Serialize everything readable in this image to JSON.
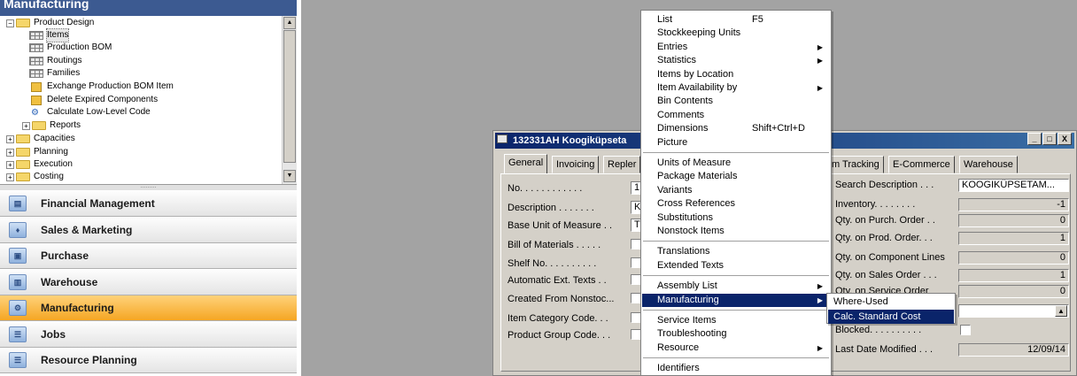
{
  "header": {
    "title": "Manufacturing"
  },
  "tree": [
    {
      "label": "Product Design",
      "kind": "folder-open",
      "level": 0
    },
    {
      "label": "Items",
      "kind": "grid",
      "level": 1,
      "selected": true
    },
    {
      "label": "Production BOM",
      "kind": "grid",
      "level": 1
    },
    {
      "label": "Routings",
      "kind": "grid",
      "level": 1
    },
    {
      "label": "Families",
      "kind": "grid",
      "level": 1
    },
    {
      "label": "Exchange Production BOM Item",
      "kind": "report",
      "level": 1
    },
    {
      "label": "Delete Expired Components",
      "kind": "report",
      "level": 1
    },
    {
      "label": "Calculate Low-Level Code",
      "kind": "calc",
      "level": 1
    },
    {
      "label": "Reports",
      "kind": "folder",
      "level": 1
    },
    {
      "label": "Capacities",
      "kind": "folder",
      "level": 0
    },
    {
      "label": "Planning",
      "kind": "folder",
      "level": 0
    },
    {
      "label": "Execution",
      "kind": "folder",
      "level": 0
    },
    {
      "label": "Costing",
      "kind": "folder",
      "level": 0
    }
  ],
  "nav": [
    {
      "label": "Financial Management",
      "active": false
    },
    {
      "label": "Sales & Marketing",
      "active": false
    },
    {
      "label": "Purchase",
      "active": false
    },
    {
      "label": "Warehouse",
      "active": false
    },
    {
      "label": "Manufacturing",
      "active": true
    },
    {
      "label": "Jobs",
      "active": false
    },
    {
      "label": "Resource Planning",
      "active": false
    }
  ],
  "card": {
    "title": "132331AH Koogiküpseta",
    "buttons": {
      "minimize": "_",
      "maximize": "□",
      "close": "X"
    },
    "tabs": [
      "General",
      "Invoicing",
      "Repler",
      "m Tracking",
      "E-Commerce",
      "Warehouse"
    ],
    "left_fields": [
      {
        "label": "No. . . . . . . . . . . .",
        "value": "1",
        "type": "text"
      },
      {
        "label": "Description . . . . . . .",
        "value": "K",
        "type": "text"
      },
      {
        "label": "Base Unit of Measure . .",
        "value": "T",
        "type": "text"
      },
      {
        "label": "Bill of Materials . . . . .",
        "type": "check"
      },
      {
        "label": "Shelf No. . . . . . . . . .",
        "type": "check"
      },
      {
        "label": "Automatic Ext. Texts . .",
        "type": "check"
      },
      {
        "label": "Created From Nonstoc...",
        "type": "check"
      },
      {
        "label": "Item Category Code. . .",
        "type": "check"
      },
      {
        "label": "Product Group Code. . .",
        "type": "check"
      }
    ],
    "right_fields": [
      {
        "label": "Search Description . . .",
        "value": "KOOGIKÜPSETAM..."
      },
      {
        "label": "Inventory. . . . . . . .",
        "value": "-1"
      },
      {
        "label": "Qty. on Purch. Order . .",
        "value": "0"
      },
      {
        "label": "Qty. on Prod. Order. . .",
        "value": "1"
      },
      {
        "label": "Qty. on Component Lines",
        "value": "0"
      },
      {
        "label": "Qty. on Sales Order . . .",
        "value": "1"
      },
      {
        "label": "Qty. on Service Order",
        "value": "0"
      },
      {
        "label": "",
        "value": ""
      },
      {
        "label": "Blocked. . . . . . . . . .",
        "value": ""
      },
      {
        "label": "Last Date Modified . . .",
        "value": "12/09/14"
      }
    ]
  },
  "menu": {
    "items": [
      {
        "label": "List",
        "shortcut": "F5"
      },
      {
        "label": "Stockkeeping Units"
      },
      {
        "label": "Entries",
        "submenu": true
      },
      {
        "label": "Statistics",
        "submenu": true
      },
      {
        "label": "Items by Location"
      },
      {
        "label": "Item Availability by",
        "submenu": true
      },
      {
        "label": "Bin Contents"
      },
      {
        "label": "Comments"
      },
      {
        "label": "Dimensions",
        "shortcut": "Shift+Ctrl+D"
      },
      {
        "label": "Picture"
      },
      {
        "separator": true
      },
      {
        "label": "Units of Measure"
      },
      {
        "label": "Package Materials"
      },
      {
        "label": "Variants"
      },
      {
        "label": "Cross References"
      },
      {
        "label": "Substitutions"
      },
      {
        "label": "Nonstock Items"
      },
      {
        "separator": true
      },
      {
        "label": "Translations"
      },
      {
        "label": "Extended Texts"
      },
      {
        "separator": true
      },
      {
        "label": "Assembly List",
        "submenu": true
      },
      {
        "label": "Manufacturing",
        "submenu": true,
        "highlighted": true
      },
      {
        "separator": true
      },
      {
        "label": "Service Items"
      },
      {
        "label": "Troubleshooting"
      },
      {
        "label": "Resource",
        "submenu": true
      },
      {
        "separator": true
      },
      {
        "label": "Identifiers"
      }
    ],
    "submenu": [
      {
        "label": "Where-Used"
      },
      {
        "label": "Calc. Standard Cost",
        "highlighted": true
      }
    ]
  },
  "colors": {
    "menu_highlight": "#0a246a",
    "nav_active": "#f5a623",
    "title_bar": "#0a246a"
  }
}
